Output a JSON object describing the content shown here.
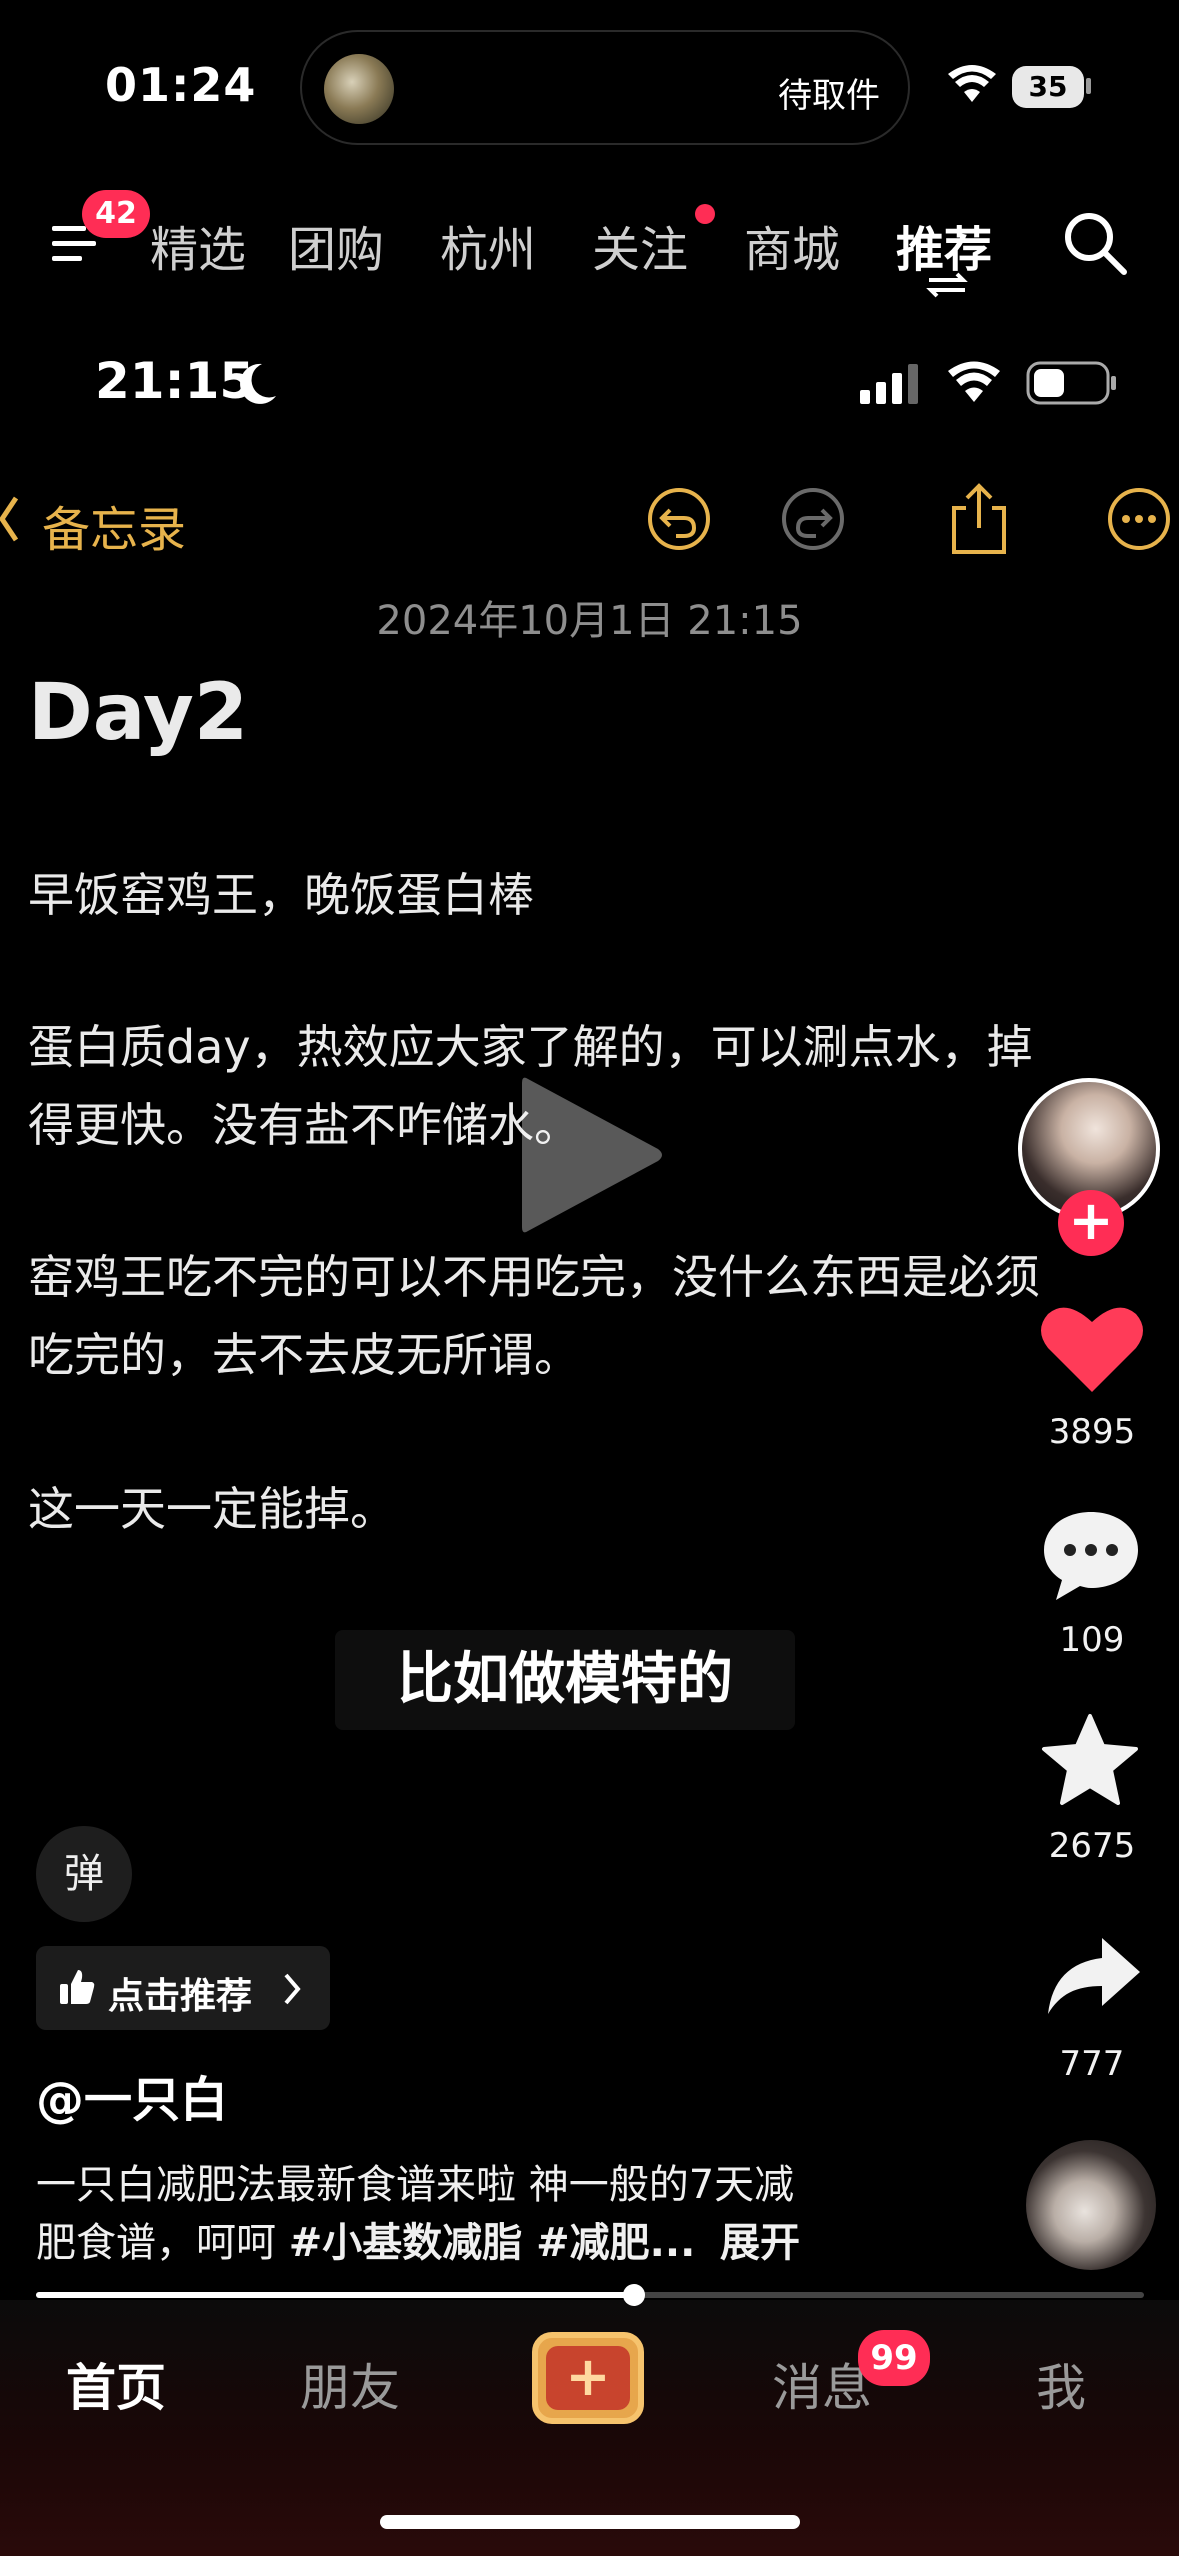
{
  "status_bar": {
    "time": "01:24",
    "island_text": "待取件",
    "battery": "35"
  },
  "nav": {
    "menu_badge": "42",
    "tabs": [
      "精选",
      "团购",
      "杭州",
      "关注",
      "商城",
      "推荐"
    ],
    "active_tab": "推荐"
  },
  "inner_status": {
    "time": "21:15"
  },
  "note": {
    "back_label": "备忘录",
    "date": "2024年10月1日 21:15",
    "heading": "Day2",
    "lines": [
      "早饭窑鸡王，晚饭蛋白棒",
      "蛋白质day，热效应大家了解的，可以涮点水，掉",
      "得更快。没有盐不咋储水。",
      "窑鸡王吃不完的可以不用吃完，没什么东西是必须",
      "吃完的，去不去皮无所谓。",
      "这一天一定能掉。"
    ]
  },
  "subtitle": "比如做模特的",
  "rail": {
    "likes": "3895",
    "comments": "109",
    "favorites": "2675",
    "shares": "777"
  },
  "danmu_label": "弹",
  "recommend_label": "点击推荐",
  "author": "@一只白",
  "description": {
    "line1": "一只白减肥法最新食谱来啦 神一般的7天减",
    "line2_prefix": "肥食谱，呵呵 ",
    "hashtags": "#小基数减脂 #减肥...",
    "expand": "展开"
  },
  "progress": 0.54,
  "bottom_tabs": {
    "home": "首页",
    "friends": "朋友",
    "messages": "消息",
    "me": "我",
    "messages_badge": "99"
  },
  "colors": {
    "accent_red": "#ff2d55",
    "notes_gold": "#e7b34c",
    "create_orange": "#e7a64c"
  }
}
